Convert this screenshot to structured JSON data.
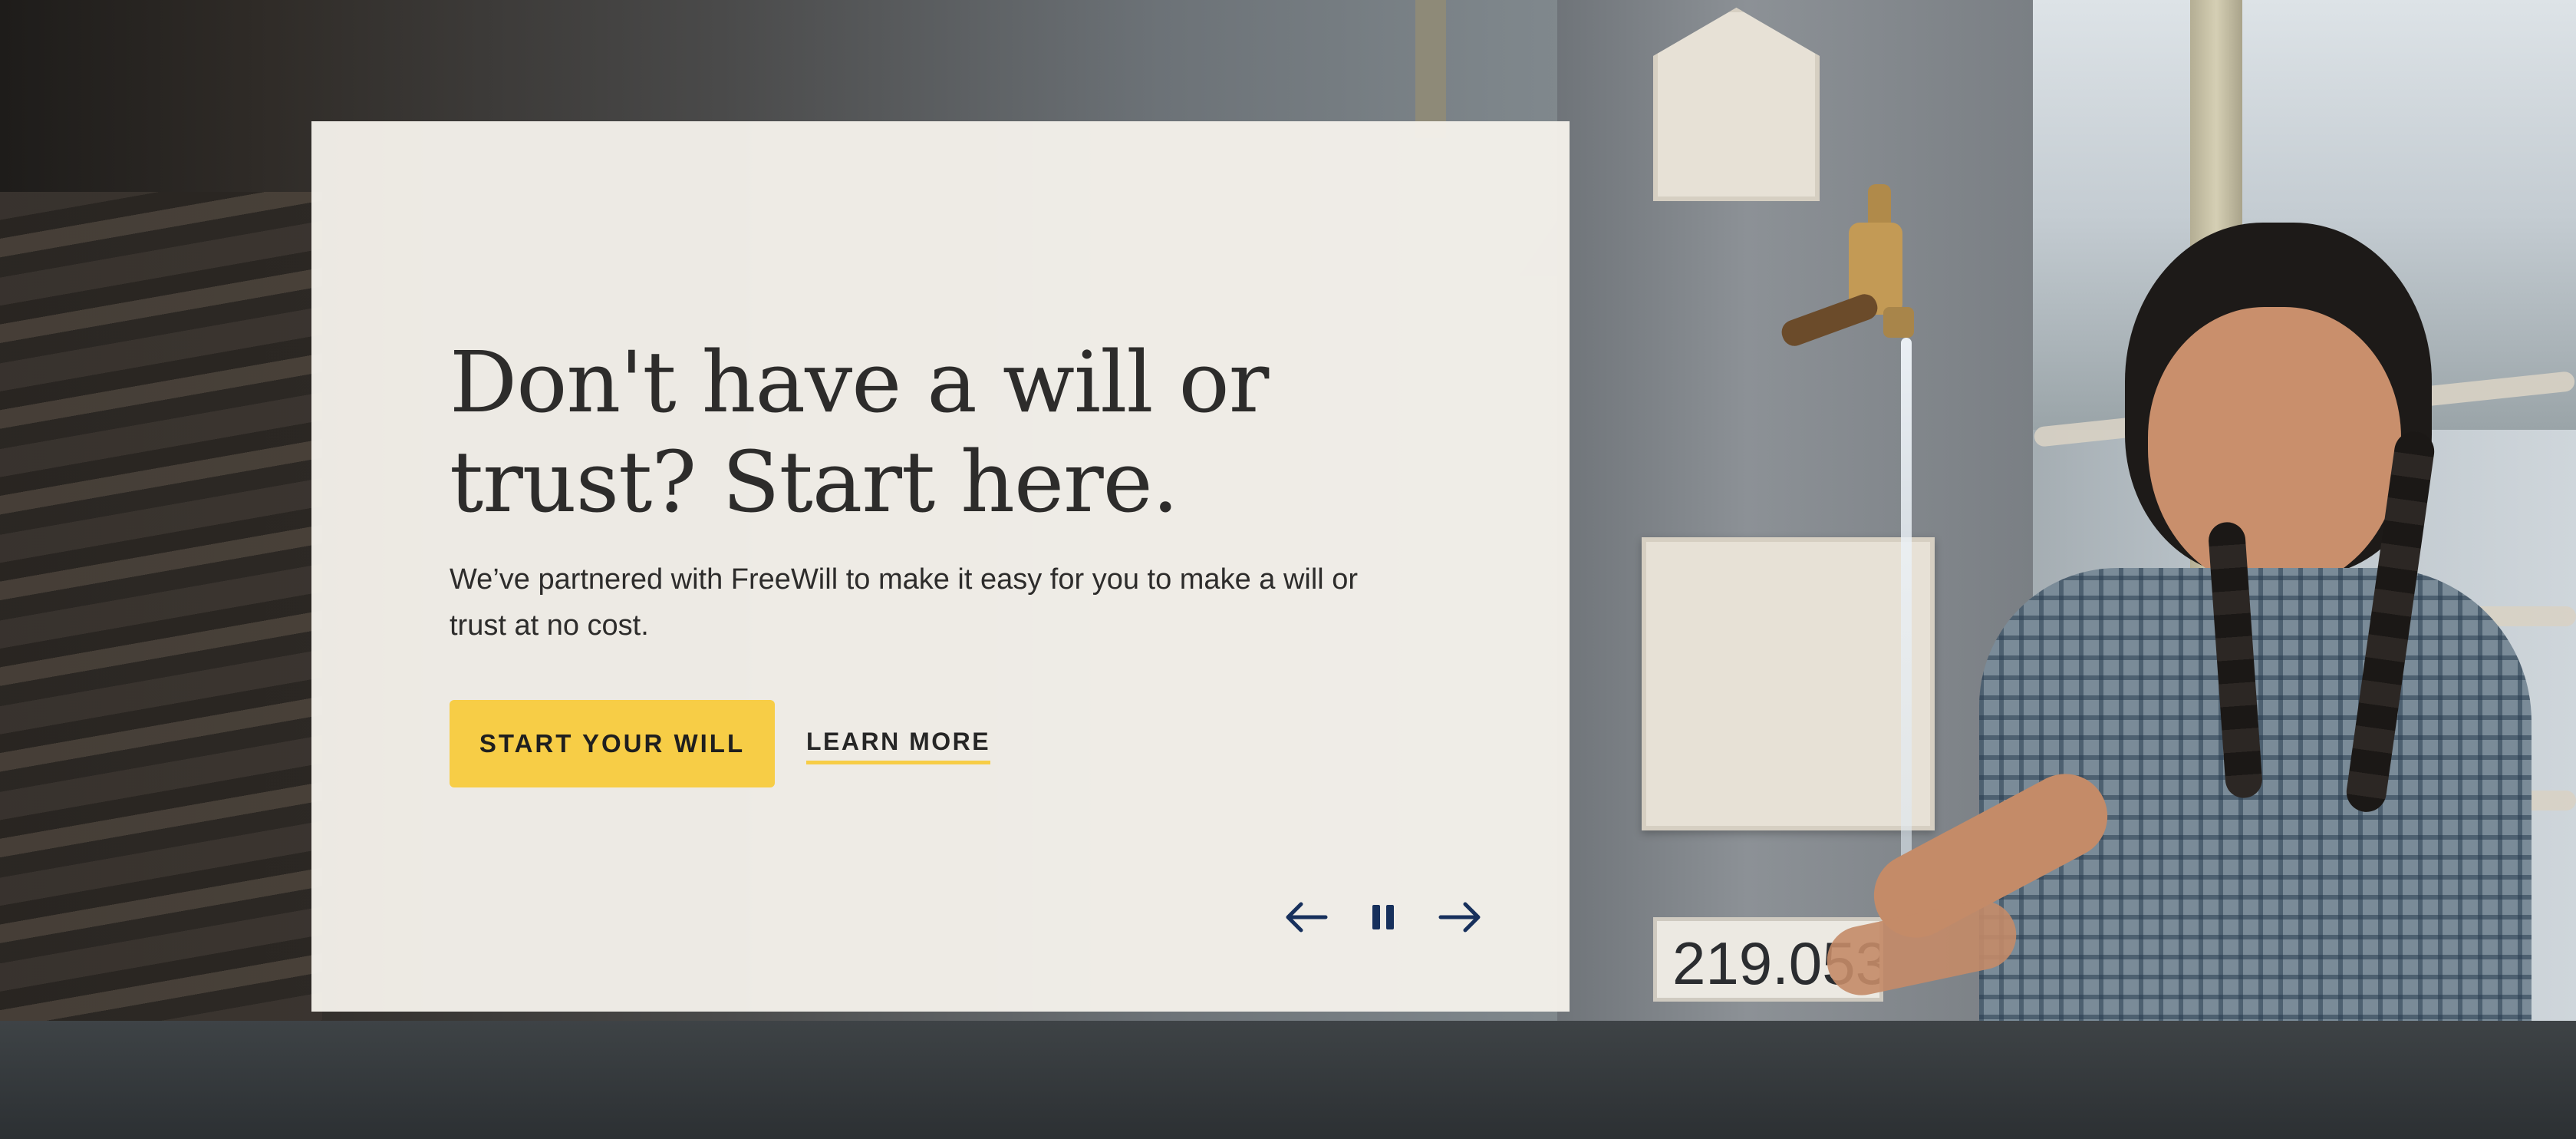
{
  "hero": {
    "headline": "Don't have a will or trust? Start here.",
    "body": "We’ve partnered with FreeWill to make it easy for you to make a will or trust at no cost.",
    "primary_cta": "START YOUR WILL",
    "secondary_cta": "LEARN MORE",
    "plaque_text": "219.053.0"
  },
  "carousel": {
    "controls": [
      {
        "name": "previous",
        "icon": "arrow-left-icon"
      },
      {
        "name": "pause",
        "icon": "pause-icon"
      },
      {
        "name": "next",
        "icon": "arrow-right-icon"
      }
    ]
  },
  "colors": {
    "accent_yellow": "#f7cd46",
    "control_navy": "#17305c",
    "card_bg": "#f4f1ea",
    "text_dark": "#2d2c2b"
  }
}
